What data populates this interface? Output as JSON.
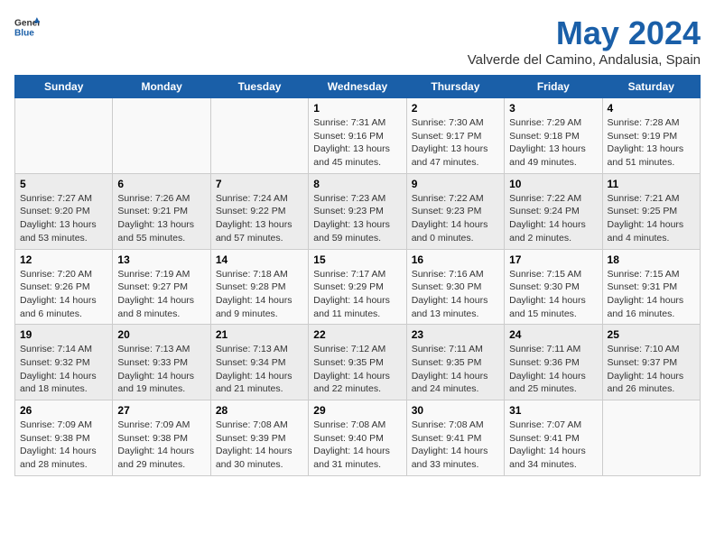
{
  "header": {
    "logo_general": "General",
    "logo_blue": "Blue",
    "title": "May 2024",
    "subtitle": "Valverde del Camino, Andalusia, Spain"
  },
  "weekdays": [
    "Sunday",
    "Monday",
    "Tuesday",
    "Wednesday",
    "Thursday",
    "Friday",
    "Saturday"
  ],
  "weeks": [
    [
      {
        "day": "",
        "detail": ""
      },
      {
        "day": "",
        "detail": ""
      },
      {
        "day": "",
        "detail": ""
      },
      {
        "day": "1",
        "detail": "Sunrise: 7:31 AM\nSunset: 9:16 PM\nDaylight: 13 hours\nand 45 minutes."
      },
      {
        "day": "2",
        "detail": "Sunrise: 7:30 AM\nSunset: 9:17 PM\nDaylight: 13 hours\nand 47 minutes."
      },
      {
        "day": "3",
        "detail": "Sunrise: 7:29 AM\nSunset: 9:18 PM\nDaylight: 13 hours\nand 49 minutes."
      },
      {
        "day": "4",
        "detail": "Sunrise: 7:28 AM\nSunset: 9:19 PM\nDaylight: 13 hours\nand 51 minutes."
      }
    ],
    [
      {
        "day": "5",
        "detail": "Sunrise: 7:27 AM\nSunset: 9:20 PM\nDaylight: 13 hours\nand 53 minutes."
      },
      {
        "day": "6",
        "detail": "Sunrise: 7:26 AM\nSunset: 9:21 PM\nDaylight: 13 hours\nand 55 minutes."
      },
      {
        "day": "7",
        "detail": "Sunrise: 7:24 AM\nSunset: 9:22 PM\nDaylight: 13 hours\nand 57 minutes."
      },
      {
        "day": "8",
        "detail": "Sunrise: 7:23 AM\nSunset: 9:23 PM\nDaylight: 13 hours\nand 59 minutes."
      },
      {
        "day": "9",
        "detail": "Sunrise: 7:22 AM\nSunset: 9:23 PM\nDaylight: 14 hours\nand 0 minutes."
      },
      {
        "day": "10",
        "detail": "Sunrise: 7:22 AM\nSunset: 9:24 PM\nDaylight: 14 hours\nand 2 minutes."
      },
      {
        "day": "11",
        "detail": "Sunrise: 7:21 AM\nSunset: 9:25 PM\nDaylight: 14 hours\nand 4 minutes."
      }
    ],
    [
      {
        "day": "12",
        "detail": "Sunrise: 7:20 AM\nSunset: 9:26 PM\nDaylight: 14 hours\nand 6 minutes."
      },
      {
        "day": "13",
        "detail": "Sunrise: 7:19 AM\nSunset: 9:27 PM\nDaylight: 14 hours\nand 8 minutes."
      },
      {
        "day": "14",
        "detail": "Sunrise: 7:18 AM\nSunset: 9:28 PM\nDaylight: 14 hours\nand 9 minutes."
      },
      {
        "day": "15",
        "detail": "Sunrise: 7:17 AM\nSunset: 9:29 PM\nDaylight: 14 hours\nand 11 minutes."
      },
      {
        "day": "16",
        "detail": "Sunrise: 7:16 AM\nSunset: 9:30 PM\nDaylight: 14 hours\nand 13 minutes."
      },
      {
        "day": "17",
        "detail": "Sunrise: 7:15 AM\nSunset: 9:30 PM\nDaylight: 14 hours\nand 15 minutes."
      },
      {
        "day": "18",
        "detail": "Sunrise: 7:15 AM\nSunset: 9:31 PM\nDaylight: 14 hours\nand 16 minutes."
      }
    ],
    [
      {
        "day": "19",
        "detail": "Sunrise: 7:14 AM\nSunset: 9:32 PM\nDaylight: 14 hours\nand 18 minutes."
      },
      {
        "day": "20",
        "detail": "Sunrise: 7:13 AM\nSunset: 9:33 PM\nDaylight: 14 hours\nand 19 minutes."
      },
      {
        "day": "21",
        "detail": "Sunrise: 7:13 AM\nSunset: 9:34 PM\nDaylight: 14 hours\nand 21 minutes."
      },
      {
        "day": "22",
        "detail": "Sunrise: 7:12 AM\nSunset: 9:35 PM\nDaylight: 14 hours\nand 22 minutes."
      },
      {
        "day": "23",
        "detail": "Sunrise: 7:11 AM\nSunset: 9:35 PM\nDaylight: 14 hours\nand 24 minutes."
      },
      {
        "day": "24",
        "detail": "Sunrise: 7:11 AM\nSunset: 9:36 PM\nDaylight: 14 hours\nand 25 minutes."
      },
      {
        "day": "25",
        "detail": "Sunrise: 7:10 AM\nSunset: 9:37 PM\nDaylight: 14 hours\nand 26 minutes."
      }
    ],
    [
      {
        "day": "26",
        "detail": "Sunrise: 7:09 AM\nSunset: 9:38 PM\nDaylight: 14 hours\nand 28 minutes."
      },
      {
        "day": "27",
        "detail": "Sunrise: 7:09 AM\nSunset: 9:38 PM\nDaylight: 14 hours\nand 29 minutes."
      },
      {
        "day": "28",
        "detail": "Sunrise: 7:08 AM\nSunset: 9:39 PM\nDaylight: 14 hours\nand 30 minutes."
      },
      {
        "day": "29",
        "detail": "Sunrise: 7:08 AM\nSunset: 9:40 PM\nDaylight: 14 hours\nand 31 minutes."
      },
      {
        "day": "30",
        "detail": "Sunrise: 7:08 AM\nSunset: 9:41 PM\nDaylight: 14 hours\nand 33 minutes."
      },
      {
        "day": "31",
        "detail": "Sunrise: 7:07 AM\nSunset: 9:41 PM\nDaylight: 14 hours\nand 34 minutes."
      },
      {
        "day": "",
        "detail": ""
      }
    ]
  ]
}
